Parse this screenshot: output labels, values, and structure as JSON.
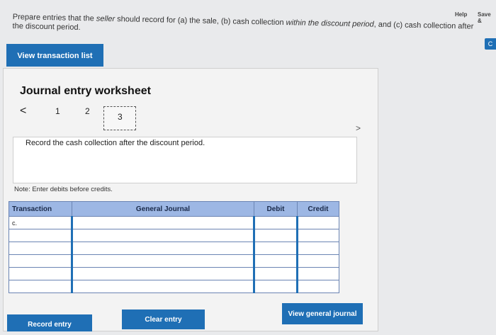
{
  "topbar": {
    "help": "Help",
    "save": "Save &"
  },
  "side_tab": "C",
  "instructions": {
    "prefix": "Prepare entries that the ",
    "seller": "seller",
    "middle": " should record for (a) the sale, (b) cash collection ",
    "within": "within the discount period",
    "end1": ", and (c) cash collection after",
    "line2": "the discount period."
  },
  "view_transaction_list": "View transaction list",
  "worksheet": {
    "title": "Journal entry worksheet",
    "pager": {
      "prev": "<",
      "pages": [
        "1",
        "2",
        "3"
      ],
      "next": ">"
    },
    "record_text": "Record the cash collection after the discount period.",
    "note": "Note: Enter debits before credits."
  },
  "journal": {
    "headers": [
      "Transaction",
      "General Journal",
      "Debit",
      "Credit"
    ],
    "rows": [
      {
        "transaction": "c.",
        "account": "",
        "debit": "",
        "credit": ""
      },
      {
        "transaction": "",
        "account": "",
        "debit": "",
        "credit": ""
      },
      {
        "transaction": "",
        "account": "",
        "debit": "",
        "credit": ""
      },
      {
        "transaction": "",
        "account": "",
        "debit": "",
        "credit": ""
      },
      {
        "transaction": "",
        "account": "",
        "debit": "",
        "credit": ""
      },
      {
        "transaction": "",
        "account": "",
        "debit": "",
        "credit": ""
      }
    ]
  },
  "buttons": {
    "record_entry": "Record entry",
    "clear_entry": "Clear entry",
    "view_general_journal": "View general journal"
  },
  "colors": {
    "accent": "#1f6fb5",
    "header": "#9db7e4"
  }
}
